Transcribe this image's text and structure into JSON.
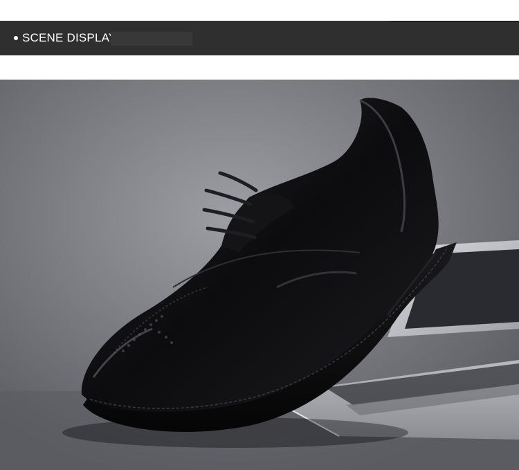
{
  "header": {
    "title": "SCENE DISPLAY"
  },
  "scene": {
    "background_color": "#7f8086",
    "subject": "shoe-photo",
    "shoe_color": "#0e0e10",
    "laptop_color": "#c9cbd0"
  }
}
